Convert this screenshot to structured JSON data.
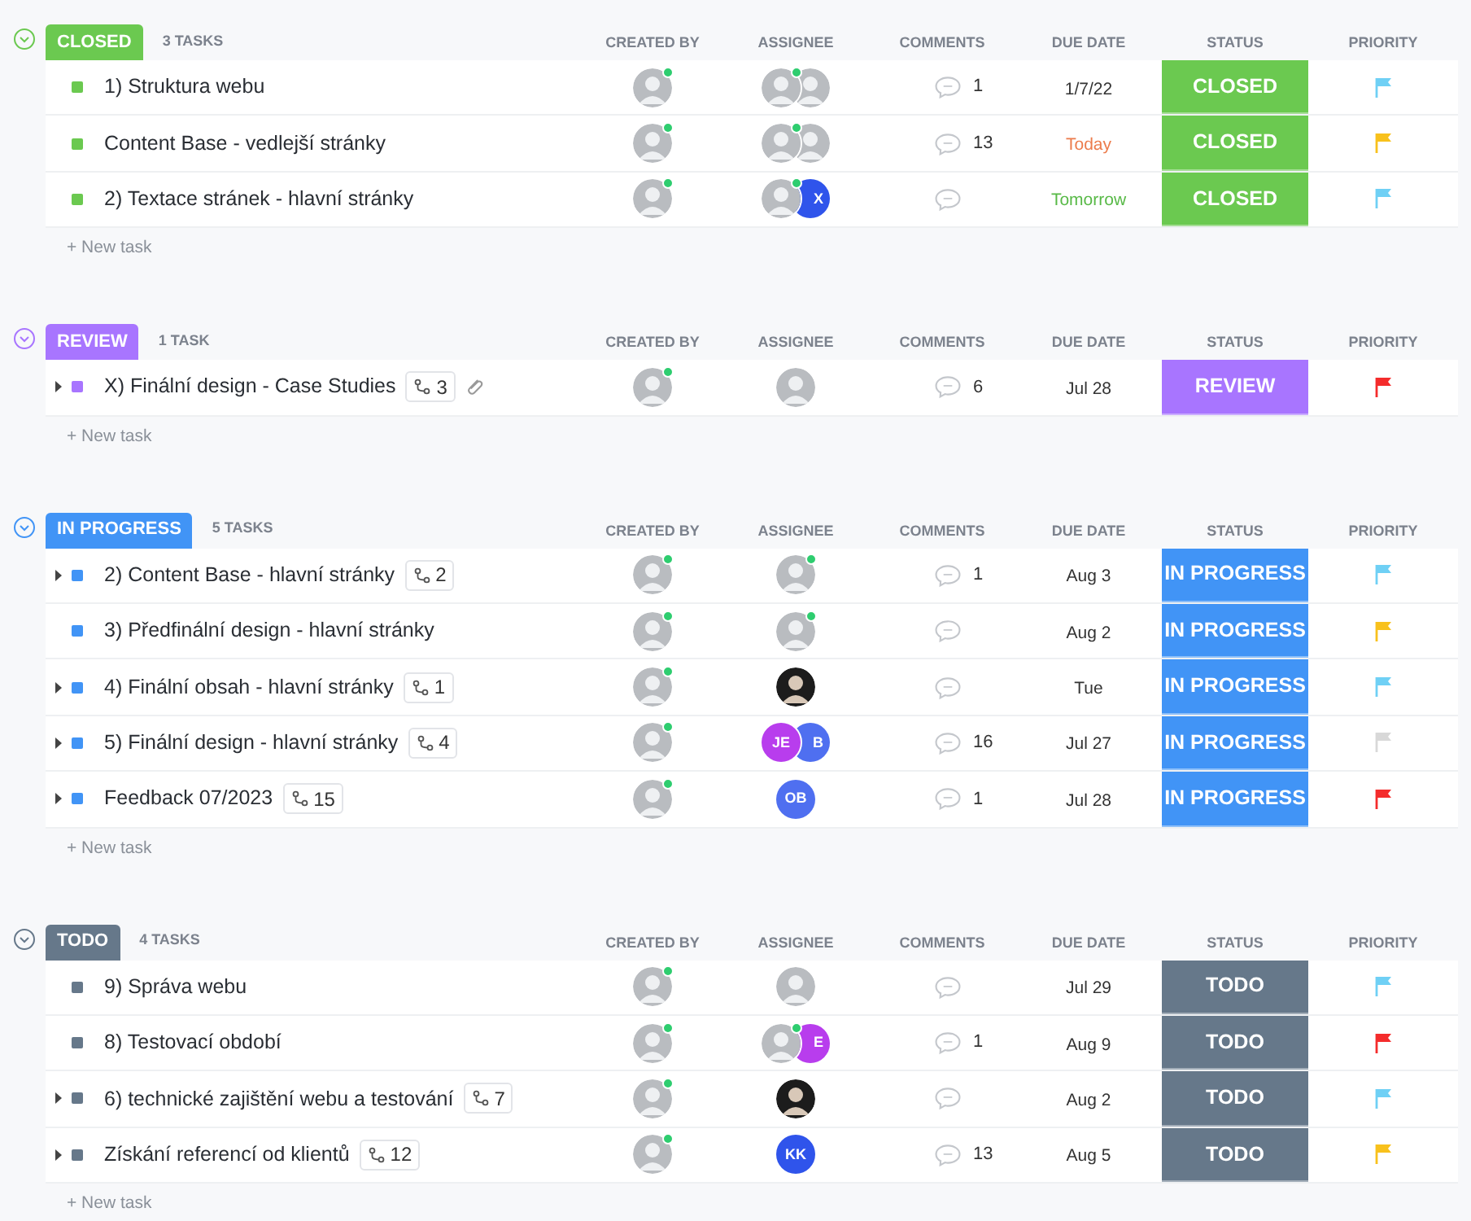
{
  "groups": [
    {
      "label": "CLOSED",
      "color": "#6bc950",
      "count": "3 TASKS",
      "expanded": true,
      "columns": [
        "CREATED BY",
        "ASSIGNEE",
        "COMMENTS",
        "DUE DATE",
        "STATUS",
        "PRIORITY"
      ],
      "new_task": "+ New task",
      "tasks": [
        {
          "name": "1) Struktura webu",
          "expandable": false,
          "creator": {
            "kind": "photo",
            "online": true
          },
          "assignees": [
            {
              "kind": "photo",
              "online": true
            },
            {
              "kind": "photo",
              "online": false
            }
          ],
          "comments": "1",
          "due": "1/7/22",
          "due_today": false,
          "due_tomorrow": false,
          "status": "CLOSED",
          "color": "#6fd0f5"
        },
        {
          "name": "Content Base - vedlejší stránky",
          "expandable": false,
          "creator": {
            "kind": "photo",
            "online": true
          },
          "assignees": [
            {
              "kind": "photo",
              "online": true
            },
            {
              "kind": "photo",
              "online": false
            }
          ],
          "comments": "13",
          "due": "Today",
          "due_today": true,
          "due_tomorrow": false,
          "status": "CLOSED",
          "color": "#f8c11c"
        },
        {
          "name": "2) Textace stránek - hlavní stránky",
          "expandable": false,
          "creator": {
            "kind": "photo",
            "online": true
          },
          "assignees": [
            {
              "kind": "photo",
              "online": true
            },
            {
              "kind": "initials",
              "initials": "X",
              "color": "#2f54eb"
            }
          ],
          "due": "Tomorrow",
          "due_today": false,
          "due_tomorrow": true,
          "status": "CLOSED",
          "color": "#6fd0f5"
        }
      ]
    },
    {
      "label": "REVIEW",
      "color": "#a875ff",
      "count": "1 TASK",
      "expanded": true,
      "columns": [
        "CREATED BY",
        "ASSIGNEE",
        "COMMENTS",
        "DUE DATE",
        "STATUS",
        "PRIORITY"
      ],
      "new_task": "+ New task",
      "tasks": [
        {
          "name": "X) Finální design - Case Studies",
          "expandable": true,
          "subtasks": "3",
          "attachment": true,
          "creator": {
            "kind": "photo",
            "online": true
          },
          "assignees": [
            {
              "kind": "photo",
              "online": false
            }
          ],
          "comments": "6",
          "due": "Jul 28",
          "due_today": false,
          "due_tomorrow": false,
          "status": "REVIEW",
          "color": "#f42c2c"
        }
      ]
    },
    {
      "label": "IN PROGRESS",
      "color": "#4194f6",
      "count": "5 TASKS",
      "expanded": true,
      "columns": [
        "CREATED BY",
        "ASSIGNEE",
        "COMMENTS",
        "DUE DATE",
        "STATUS",
        "PRIORITY"
      ],
      "new_task": "+ New task",
      "tasks": [
        {
          "name": "2) Content Base - hlavní stránky",
          "expandable": true,
          "subtasks": "2",
          "creator": {
            "kind": "photo",
            "online": true
          },
          "assignees": [
            {
              "kind": "photo",
              "online": true
            }
          ],
          "comments": "1",
          "due": "Aug 3",
          "due_today": false,
          "due_tomorrow": false,
          "status": "IN PROGRESS",
          "color": "#6fd0f5"
        },
        {
          "name": "3) Předfinální design - hlavní stránky",
          "expandable": false,
          "creator": {
            "kind": "photo",
            "online": true
          },
          "assignees": [
            {
              "kind": "photo",
              "online": true
            }
          ],
          "due": "Aug 2",
          "due_today": false,
          "due_tomorrow": false,
          "status": "IN PROGRESS",
          "color": "#f8c11c"
        },
        {
          "name": "4) Finální obsah - hlavní stránky",
          "expandable": true,
          "subtasks": "1",
          "creator": {
            "kind": "photo",
            "online": true
          },
          "assignees": [
            {
              "kind": "dark-photo",
              "online": false
            }
          ],
          "due": "Tue",
          "due_today": false,
          "due_tomorrow": false,
          "status": "IN PROGRESS",
          "color": "#6fd0f5"
        },
        {
          "name": "5) Finální design - hlavní stránky",
          "expandable": true,
          "subtasks": "4",
          "creator": {
            "kind": "photo",
            "online": true
          },
          "assignees": [
            {
              "kind": "initials",
              "initials": "JE",
              "color": "#b83ded"
            },
            {
              "kind": "initials",
              "initials": "B",
              "color": "#4f6ff0"
            }
          ],
          "comments": "16",
          "due": "Jul 27",
          "due_today": false,
          "due_tomorrow": false,
          "status": "IN PROGRESS",
          "color": "#d8d8d8"
        },
        {
          "name": "Feedback 07/2023",
          "expandable": true,
          "subtasks": "15",
          "creator": {
            "kind": "photo",
            "online": true
          },
          "assignees": [
            {
              "kind": "initials",
              "initials": "OB",
              "color": "#4f6ff0"
            }
          ],
          "comments": "1",
          "due": "Jul 28",
          "due_today": false,
          "due_tomorrow": false,
          "status": "IN PROGRESS",
          "color": "#f42c2c"
        }
      ]
    },
    {
      "label": "TODO",
      "color": "#66788a",
      "count": "4 TASKS",
      "expanded": true,
      "columns": [
        "CREATED BY",
        "ASSIGNEE",
        "COMMENTS",
        "DUE DATE",
        "STATUS",
        "PRIORITY"
      ],
      "new_task": "+ New task",
      "tasks": [
        {
          "name": "9) Správa webu",
          "expandable": false,
          "creator": {
            "kind": "photo",
            "online": true
          },
          "assignees": [
            {
              "kind": "photo",
              "online": false
            }
          ],
          "due": "Jul 29",
          "due_today": false,
          "due_tomorrow": false,
          "status": "TODO",
          "color": "#6fd0f5"
        },
        {
          "name": "8) Testovací období",
          "expandable": false,
          "creator": {
            "kind": "photo",
            "online": true
          },
          "assignees": [
            {
              "kind": "photo",
              "online": true
            },
            {
              "kind": "initials",
              "initials": "E",
              "color": "#b83ded"
            }
          ],
          "comments": "1",
          "due": "Aug 9",
          "due_today": false,
          "due_tomorrow": false,
          "status": "TODO",
          "color": "#f42c2c"
        },
        {
          "name": "6) technické zajištění webu a testování",
          "expandable": true,
          "subtasks": "7",
          "creator": {
            "kind": "photo",
            "online": true
          },
          "assignees": [
            {
              "kind": "dark-photo",
              "online": false
            }
          ],
          "due": "Aug 2",
          "due_today": false,
          "due_tomorrow": false,
          "status": "TODO",
          "color": "#6fd0f5"
        },
        {
          "name": "Získání referencí od klientů",
          "expandable": true,
          "subtasks": "12",
          "creator": {
            "kind": "photo",
            "online": true
          },
          "assignees": [
            {
              "kind": "initials",
              "initials": "KK",
              "color": "#2f54eb"
            }
          ],
          "comments": "13",
          "due": "Aug 5",
          "due_today": false,
          "due_tomorrow": false,
          "status": "TODO",
          "color": "#f8c11c"
        }
      ]
    }
  ]
}
